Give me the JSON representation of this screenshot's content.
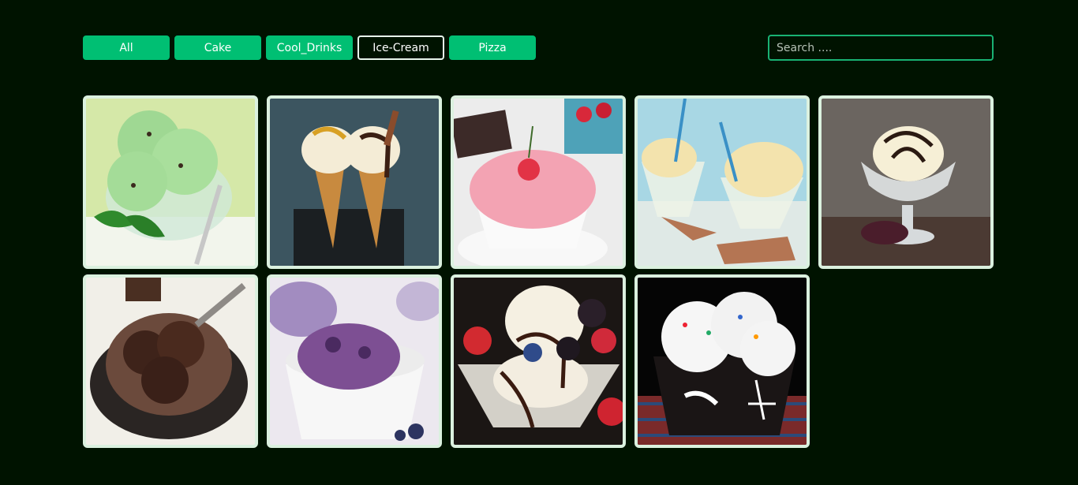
{
  "filters": [
    {
      "label": "All",
      "active": false
    },
    {
      "label": "Cake",
      "active": false
    },
    {
      "label": "Cool_Drinks",
      "active": false
    },
    {
      "label": "Ice-Cream",
      "active": true
    },
    {
      "label": "Pizza",
      "active": false
    }
  ],
  "search": {
    "placeholder": "Search ...."
  },
  "gallery": {
    "items": [
      {
        "name": "mint-chip-ice-cream"
      },
      {
        "name": "ice-cream-cones"
      },
      {
        "name": "strawberry-ice-cream"
      },
      {
        "name": "vanilla-ice-cream-cups"
      },
      {
        "name": "vanilla-chocolate-sundae"
      },
      {
        "name": "chocolate-ice-cream"
      },
      {
        "name": "blueberry-ice-cream"
      },
      {
        "name": "berry-sundae"
      },
      {
        "name": "sprinkle-ice-cream-bowl"
      }
    ]
  }
}
